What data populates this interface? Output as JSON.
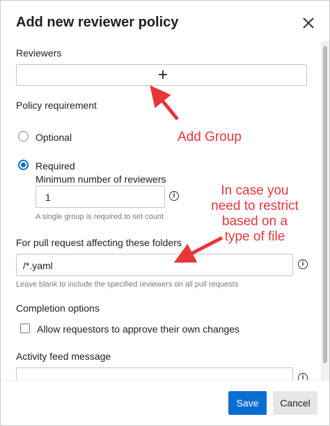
{
  "dialog": {
    "title": "Add new reviewer policy",
    "close_icon": "close-icon"
  },
  "reviewers": {
    "label": "Reviewers",
    "add_icon": "plus-icon"
  },
  "policy": {
    "label": "Policy requirement",
    "optional_label": "Optional",
    "required_label": "Required",
    "selected": "Required",
    "min_label": "Minimum number of reviewers",
    "min_value": "1",
    "min_hint": "A single group is required to set count",
    "info_icon": "info-icon"
  },
  "folders": {
    "label": "For pull request affecting these folders",
    "value": "/*.yaml",
    "hint": "Leave blank to include the specified reviewers on all pull requests",
    "info_icon": "info-icon"
  },
  "completion": {
    "label": "Completion options",
    "allow_label": "Allow requestors to approve their own changes",
    "allow_checked": false
  },
  "activity": {
    "label": "Activity feed message",
    "value": ""
  },
  "footer": {
    "save_label": "Save",
    "cancel_label": "Cancel"
  },
  "annotations": {
    "add_group": "Add Group",
    "restrict_line1": "In case you",
    "restrict_line2": "need to restrict",
    "restrict_line3": "based on a",
    "restrict_line4": "type of file"
  },
  "colors": {
    "accent": "#0a6ed1",
    "annotation": "#e8363a"
  }
}
